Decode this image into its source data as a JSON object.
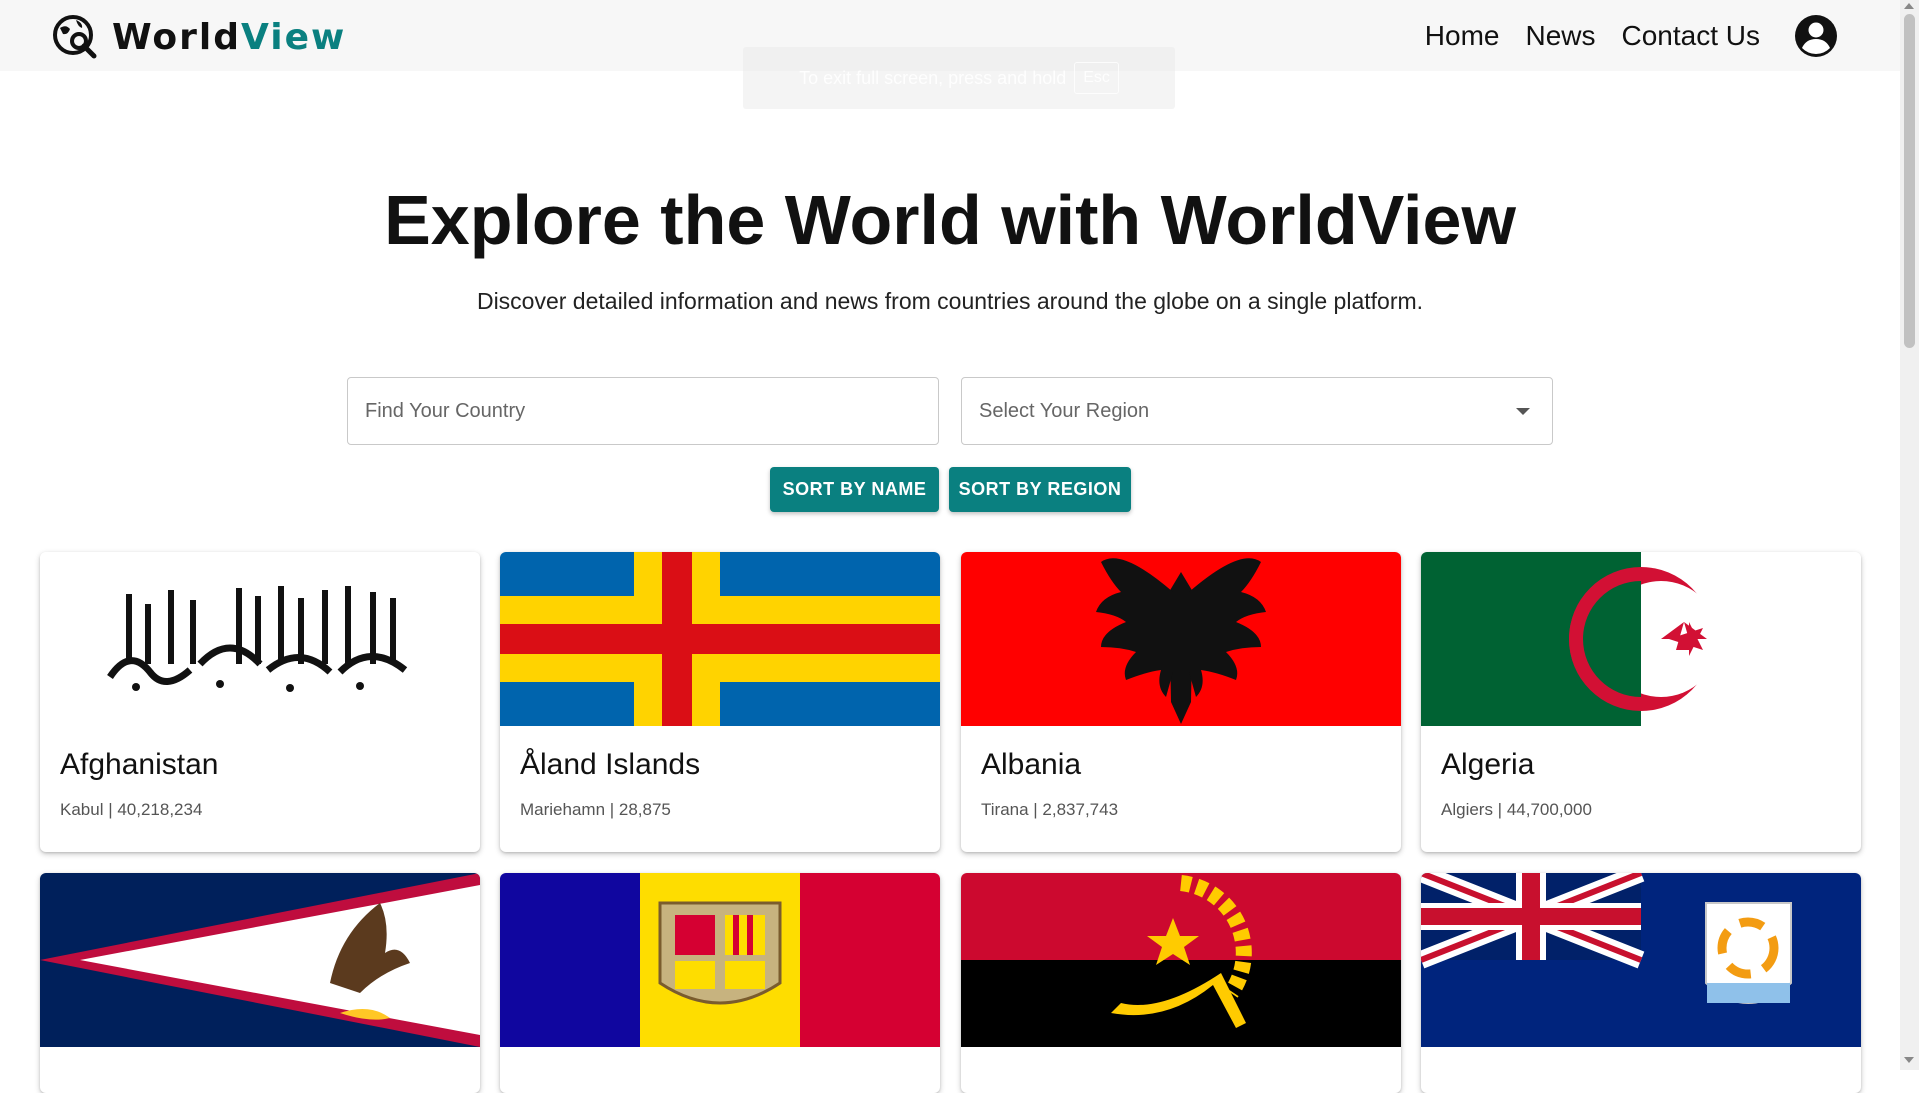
{
  "header": {
    "logo_word1": "World",
    "logo_word2": "View",
    "nav": [
      "Home",
      "News",
      "Contact Us"
    ]
  },
  "fullscreen_notice": {
    "text": "To exit full screen, press and hold",
    "key": "Esc"
  },
  "hero": {
    "title": "Explore the World with WorldView",
    "subtitle": "Discover detailed information and news from countries around the globe on a single platform."
  },
  "search": {
    "placeholder": "Find Your Country",
    "region_placeholder": "Select Your Region"
  },
  "sort_buttons": {
    "by_name": "SORT BY NAME",
    "by_region": "SORT BY REGION"
  },
  "countries": [
    {
      "name": "Afghanistan",
      "info": "Kabul | 40,218,234"
    },
    {
      "name": "Åland Islands",
      "info": "Mariehamn | 28,875"
    },
    {
      "name": "Albania",
      "info": "Tirana | 2,837,743"
    },
    {
      "name": "Algeria",
      "info": "Algiers | 44,700,000"
    }
  ],
  "colors": {
    "accent": "#0a8080",
    "header_bg": "#f7f7f7"
  }
}
